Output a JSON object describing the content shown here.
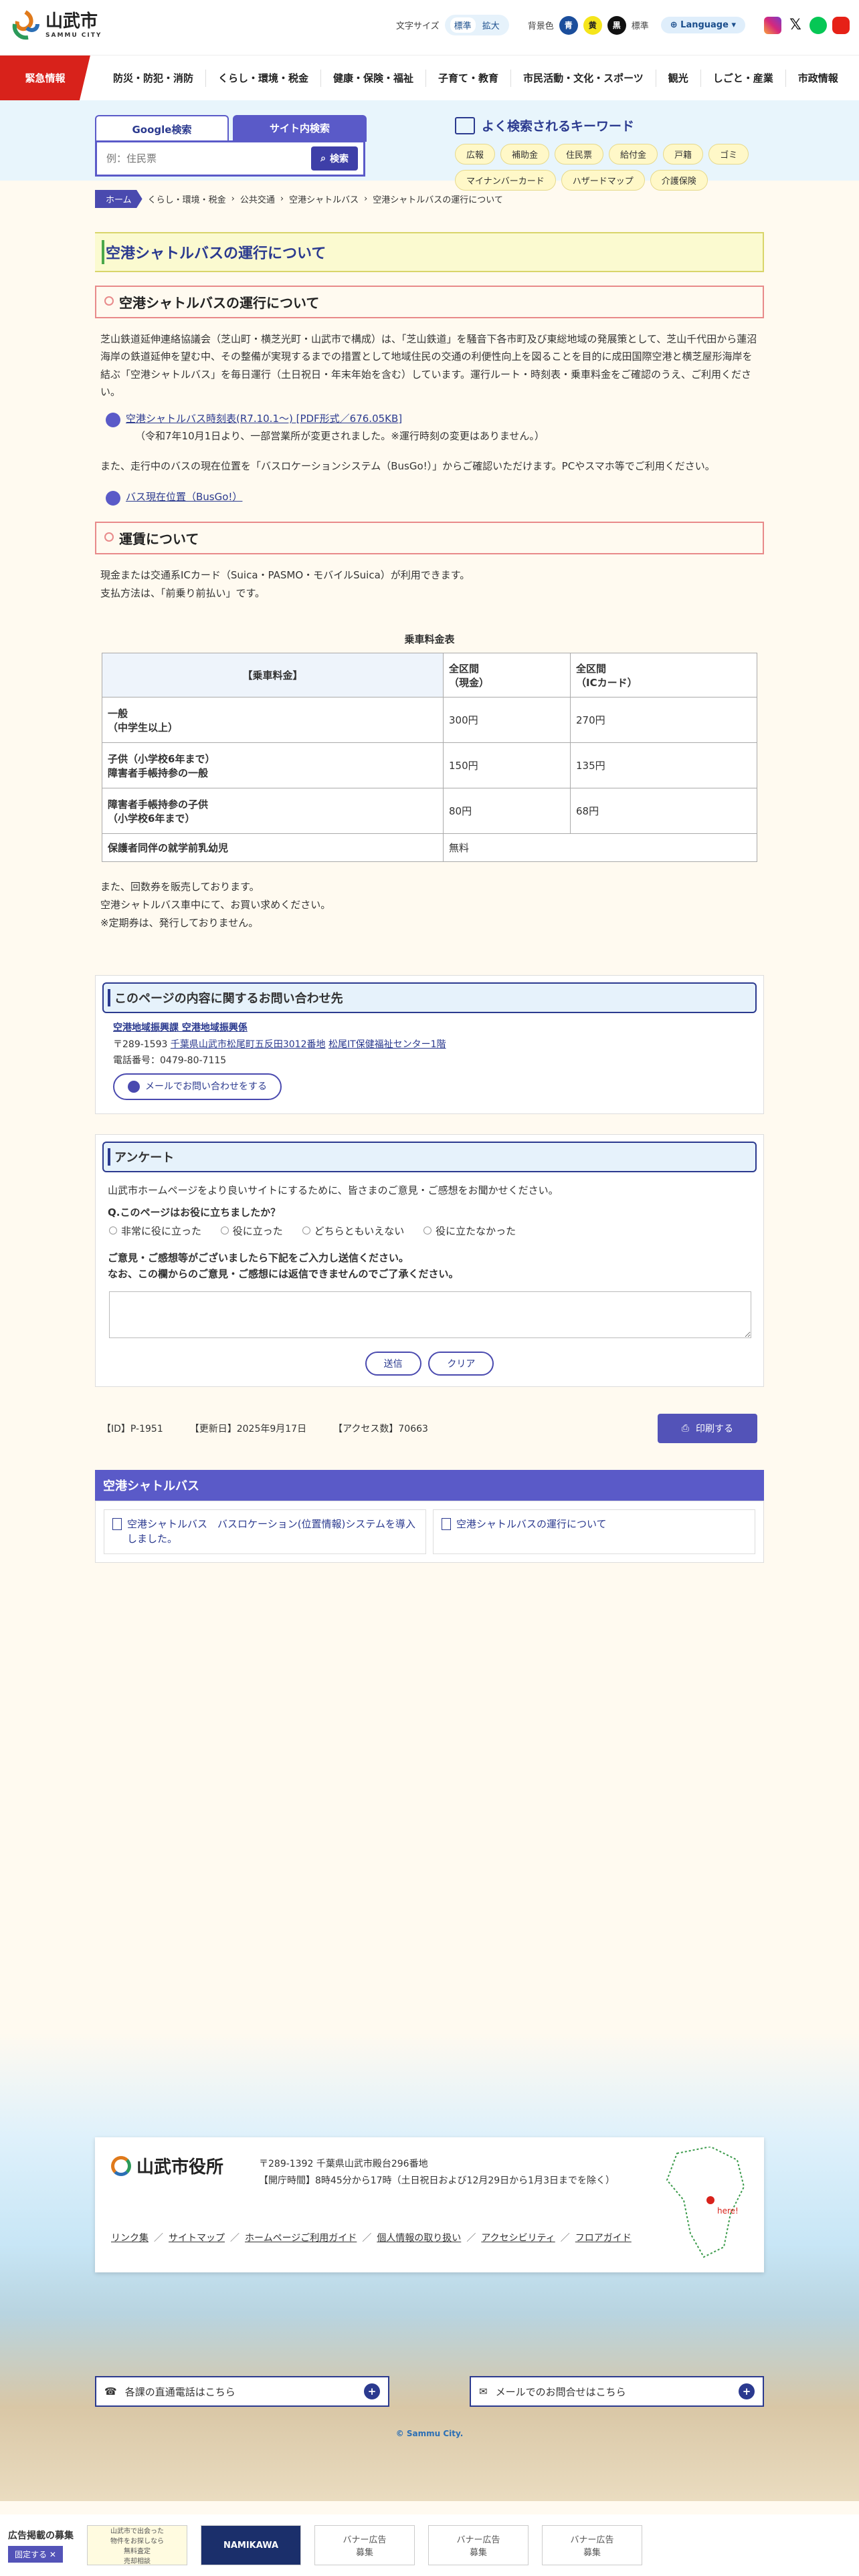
{
  "header": {
    "city_ja": "山武市",
    "city_en": "SAMMU CITY",
    "font_size_label": "文字サイズ",
    "font_std": "標準",
    "font_large": "拡大",
    "bg_color_label": "背景色",
    "bg_blue": "青",
    "bg_yellow": "黄",
    "bg_black": "黒",
    "bg_std": "標準",
    "language": "Language",
    "sns_icons": [
      "instagram-icon",
      "x-icon",
      "line-icon",
      "youtube-icon"
    ]
  },
  "nav": {
    "emergency": "緊急情報",
    "items": [
      "防災・防犯・消防",
      "くらし・環境・税金",
      "健康・保険・福祉",
      "子育て・教育",
      "市民活動・文化・スポーツ",
      "観光",
      "しごと・産業",
      "市政情報"
    ]
  },
  "search": {
    "tab_google": "Google検索",
    "tab_site": "サイト内検索",
    "placeholder": "例：住民票",
    "button": "検索",
    "kw_title": "よく検索されるキーワード",
    "keywords": [
      "広報",
      "補助金",
      "住民票",
      "給付金",
      "戸籍",
      "ゴミ",
      "マイナンバーカード",
      "ハザードマップ",
      "介護保険"
    ]
  },
  "breadcrumb": [
    "ホーム",
    "くらし・環境・税金",
    "公共交通",
    "空港シャトルバス",
    "空港シャトルバスの運行について"
  ],
  "page_title": "空港シャトルバスの運行について",
  "section1": {
    "heading": "空港シャトルバスの運行について",
    "body": "芝山鉄道延伸連絡協議会（芝山町・横芝光町・山武市で構成）は、「芝山鉄道」を騒音下各市町及び東総地域の発展策として、芝山千代田から蓮沼海岸の鉄道延伸を望む中、その整備が実現するまでの措置として地域住民の交通の利便性向上を図ることを目的に成田国際空港と横芝屋形海岸を結ぶ「空港シャトルバス」を毎日運行（土日祝日・年末年始を含む）しています。運行ルート・時刻表・乗車料金をご確認のうえ、ご利用ください。",
    "link1": "空港シャトルバス時刻表(R7.10.1〜) [PDF形式／676.05KB]",
    "link1_note": "（令和7年10月1日より、一部営業所が変更されました。※運行時刻の変更はありません。）",
    "body2": "また、走行中のバスの現在位置を「バスロケーションシステム（BusGo!）」からご確認いただけます。PCやスマホ等でご利用ください。",
    "link2": "バス現在位置（BusGo!）"
  },
  "section2": {
    "heading": "運賃について",
    "line1": "現金または交通系ICカード（Suica・PASMO・モバイルSuica）が利用できます。",
    "line2": "支払方法は、「前乗り前払い」です。",
    "table_caption": "乗車料金表",
    "col0": "【乗車料金】",
    "col1": "全区間\n（現金）",
    "col2": "全区間\n（ICカード）",
    "rows": [
      {
        "label": "一般\n（中学生以上）",
        "cash": "300円",
        "ic": "270円"
      },
      {
        "label": "子供（小学校6年まで）\n障害者手帳持参の一般",
        "cash": "150円",
        "ic": "135円"
      },
      {
        "label": "障害者手帳持参の子供\n（小学校6年まで）",
        "cash": "80円",
        "ic": "68円"
      },
      {
        "label": "保護者同伴の就学前乳幼児",
        "cash": "無料",
        "ic": ""
      }
    ],
    "note1": "また、回数券を販売しております。",
    "note2": "空港シャトルバス車中にて、お買い求めください。",
    "note3": "※定期券は、発行しておりません。"
  },
  "contact": {
    "heading": "このページの内容に関するお問い合わせ先",
    "dept": "空港地域振興課 空港地域振興係",
    "addr_prefix": "〒289-1593 ",
    "addr_link": "千葉県山武市松尾町五反田3012番地",
    "addr_link2": "松尾IT保健福祉センター1階",
    "tel": "電話番号：0479-80-7115",
    "mail_btn": "メールでお問い合わせをする"
  },
  "survey": {
    "heading": "アンケート",
    "intro": "山武市ホームページをより良いサイトにするために、皆さまのご意見・ご感想をお聞かせください。",
    "q": "Q.このページはお役に立ちましたか？",
    "options": [
      "非常に役に立った",
      "役に立った",
      "どちらともいえない",
      "役に立たなかった"
    ],
    "comment1": "ご意見・ご感想等がございましたら下記をご入力し送信ください。",
    "comment2": "なお、この欄からのご意見・ご感想には返信できませんのでご了承ください。",
    "send": "送信",
    "clear": "クリア"
  },
  "meta": {
    "id": "【ID】P-1951",
    "updated": "【更新日】2025年9月17日",
    "access": "【アクセス数】70663",
    "print": "印刷する"
  },
  "related": {
    "heading": "空港シャトルバス",
    "items": [
      "空港シャトルバス　バスロケーション(位置情報)システムを導入しました。",
      "空港シャトルバスの運行について"
    ]
  },
  "footer": {
    "office": "山武市役所",
    "address": "〒289-1392 千葉県山武市殿台296番地",
    "hours": "【開庁時間】8時45分から17時（土日祝日および12月29日から1月3日までを除く）",
    "map_label": "here!",
    "links": [
      "リンク集",
      "サイトマップ",
      "ホームページご利用ガイド",
      "個人情報の取り扱い",
      "アクセシビリティ",
      "フロアガイド"
    ],
    "cta_phone": "各課の直通電話はこちら",
    "cta_mail": "メールでのお問合せはこちら",
    "copyright": "© Sammu City."
  },
  "ads": {
    "label": "広告掲載の募集",
    "close": "固定する",
    "banner1": "山武市で出会った\n物件をお探しなら\n無料査定\n売却相談",
    "banner2": "NAMIKAWA",
    "placeholder": "バナー広告\n募集"
  }
}
